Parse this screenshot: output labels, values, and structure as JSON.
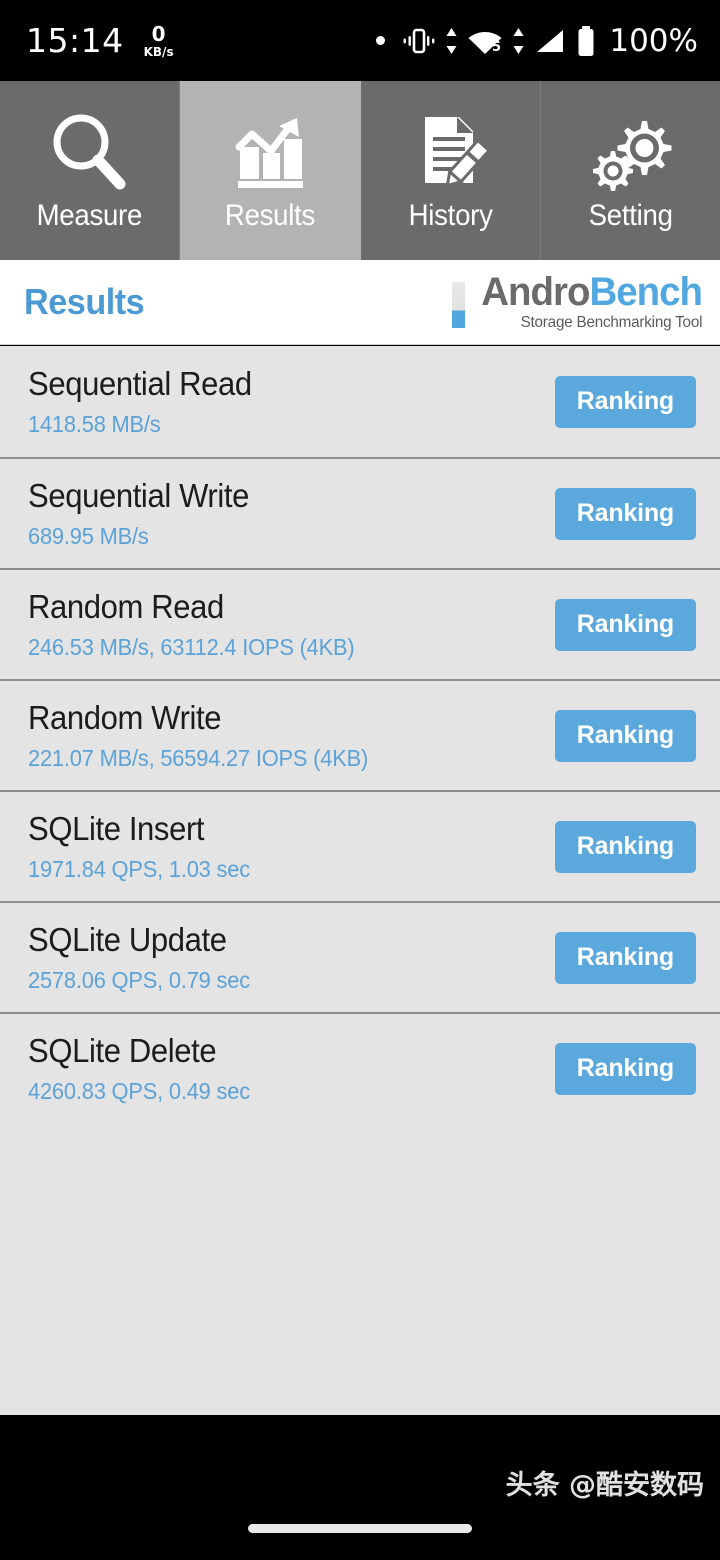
{
  "statusbar": {
    "time": "15:14",
    "netspeed_value": "0",
    "netspeed_unit": "KB/s",
    "wifi_label": "5",
    "battery_percent": "100%",
    "icons": [
      "recording-dot-icon",
      "vibrate-icon",
      "data-transfer-arrows-icon",
      "wifi-icon",
      "cellular-signal-icon",
      "battery-icon"
    ]
  },
  "tabs": [
    {
      "label": "Measure",
      "icon": "magnifier-icon",
      "active": false
    },
    {
      "label": "Results",
      "icon": "bar-chart-arrow-icon",
      "active": true
    },
    {
      "label": "History",
      "icon": "document-pencil-icon",
      "active": false
    },
    {
      "label": "Setting",
      "icon": "gears-icon",
      "active": false
    }
  ],
  "header": {
    "title": "Results",
    "logo_primary": "Andro",
    "logo_secondary": "Bench",
    "logo_tagline": "Storage Benchmarking Tool"
  },
  "results": {
    "button_label": "Ranking",
    "rows": [
      {
        "name": "Sequential Read",
        "value": "1418.58 MB/s"
      },
      {
        "name": "Sequential Write",
        "value": "689.95 MB/s"
      },
      {
        "name": "Random Read",
        "value": "246.53 MB/s, 63112.4 IOPS (4KB)"
      },
      {
        "name": "Random Write",
        "value": "221.07 MB/s, 56594.27 IOPS (4KB)"
      },
      {
        "name": "SQLite Insert",
        "value": "1971.84 QPS, 1.03 sec"
      },
      {
        "name": "SQLite Update",
        "value": "2578.06 QPS, 0.79 sec"
      },
      {
        "name": "SQLite Delete",
        "value": "4260.83 QPS, 0.49 sec"
      }
    ]
  },
  "navbar": {
    "watermark": "头条 @酷安数码"
  },
  "colors": {
    "accent_blue": "#5ba8dd",
    "title_blue": "#4c9ad4",
    "value_blue": "#5ba2d8",
    "tab_inactive": "#6b6b6b",
    "tab_active": "#b3b3b3",
    "list_bg": "#e4e4e4",
    "separator": "#8d8d8d",
    "logo_gray": "#6a6a6a"
  }
}
